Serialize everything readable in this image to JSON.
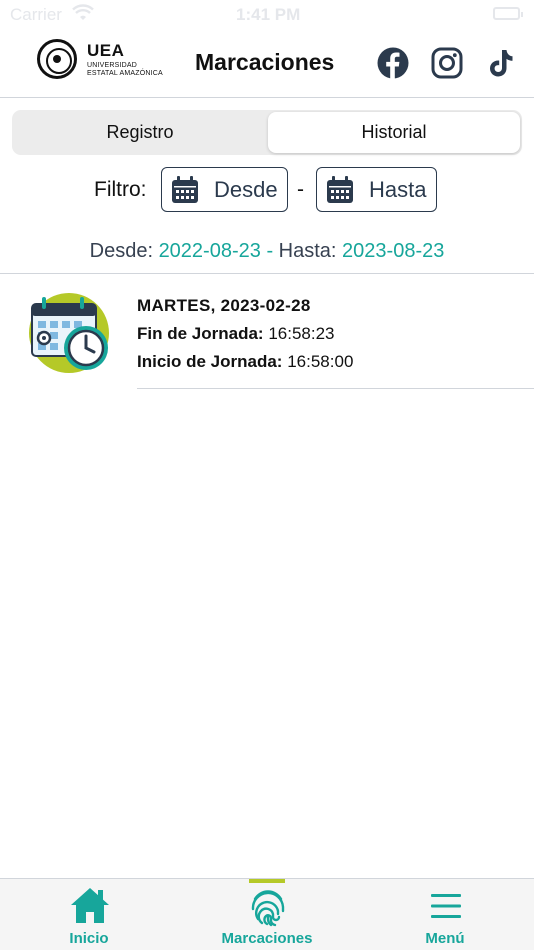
{
  "status_bar": {
    "carrier": "Carrier",
    "time": "1:41 PM"
  },
  "header": {
    "logo": {
      "abbr": "UEA",
      "name_line1": "UNIVERSIDAD",
      "name_line2": "ESTATAL AMAZÓNICA"
    },
    "title": "Marcaciones",
    "social": [
      "facebook-icon",
      "instagram-icon",
      "tiktok-icon"
    ]
  },
  "segmented": {
    "left_label": "Registro",
    "right_label": "Historial",
    "selected": "Historial"
  },
  "filter": {
    "label": "Filtro:",
    "from_label": "Desde",
    "separator": "-",
    "to_label": "Hasta"
  },
  "range": {
    "from_label": "Desde:",
    "from_value": "2022-08-23",
    "dash": "-",
    "to_label": "Hasta:",
    "to_value": "2023-08-23"
  },
  "records": [
    {
      "date": "MARTES, 2023-02-28",
      "line1_label": "Fin de Jornada:",
      "line1_value": "16:58:23",
      "line2_label": "Inicio de Jornada:",
      "line2_value": "16:58:00"
    }
  ],
  "tabs": [
    {
      "label": "Inicio",
      "icon": "home-icon"
    },
    {
      "label": "Marcaciones",
      "icon": "fingerprint-icon",
      "active": true
    },
    {
      "label": "Menú",
      "icon": "menu-icon"
    }
  ],
  "colors": {
    "accent": "#17a69b",
    "indicator": "#b5c928",
    "dark": "#2b3a4d"
  }
}
